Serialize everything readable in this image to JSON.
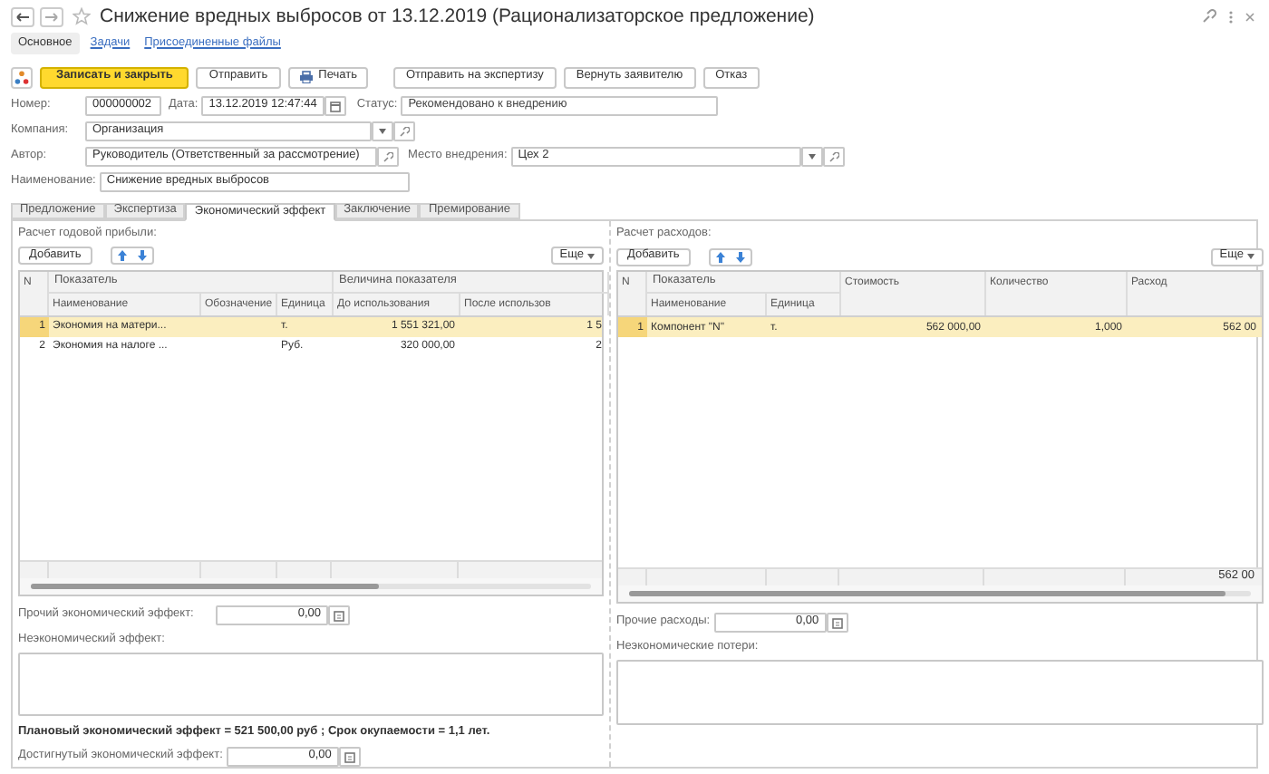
{
  "window": {
    "title": "Снижение вредных выбросов от 13.12.2019 (Рационализаторское предложение)"
  },
  "nav_tabs": [
    {
      "label": "Основное",
      "selected": true
    },
    {
      "label": "Задачи",
      "selected": false
    },
    {
      "label": "Присоединенные файлы",
      "selected": false
    }
  ],
  "toolbar": {
    "main": [
      {
        "label": "Записать и закрыть",
        "kind": "primary"
      },
      {
        "label": "Отправить",
        "kind": "plain"
      },
      {
        "label": "Печать",
        "kind": "print"
      }
    ],
    "actions": [
      {
        "label": "Отправить на экспертизу",
        "kind": "plain"
      },
      {
        "label": "Вернуть заявителю",
        "kind": "plain"
      },
      {
        "label": "Отказ",
        "kind": "plain"
      }
    ]
  },
  "header": {
    "number": {
      "label": "Номер:",
      "value": "000000002"
    },
    "date": {
      "label": "Дата:",
      "value": "13.12.2019 12:47:44"
    },
    "status": {
      "label": "Статус:",
      "value": "Рекомендовано к внедрению"
    },
    "company": {
      "label": "Компания:",
      "value": "Организация"
    },
    "author": {
      "label": "Автор:",
      "value": "Руководитель (Ответственный за рассмотрение)"
    },
    "place": {
      "label": "Место внедрения:",
      "value": "Цех 2"
    },
    "name": {
      "label": "Наименование:",
      "value": "Снижение вредных выбросов"
    }
  },
  "tabs": [
    {
      "label": "Предложение",
      "selected": false
    },
    {
      "label": "Экспертиза",
      "selected": false
    },
    {
      "label": "Экономический эффект",
      "selected": true
    },
    {
      "label": "Заключение",
      "selected": false
    },
    {
      "label": "Премирование",
      "selected": false
    }
  ],
  "profit": {
    "title": "Расчет годовой прибыли:",
    "add_button": "Добавить",
    "more_button": "Еще",
    "columns": [
      {
        "label": "N",
        "kind": "number"
      },
      {
        "label": "Показатель",
        "children": [
          {
            "label": "Наименование",
            "kind": "text"
          },
          {
            "label": "Обозначение",
            "kind": "text"
          },
          {
            "label": "Единица",
            "kind": "text"
          }
        ]
      },
      {
        "label": "Величина показателя",
        "children": [
          {
            "label": "До использования",
            "kind": "number"
          },
          {
            "label": "После использов",
            "kind": "number"
          }
        ]
      }
    ],
    "rows": [
      {
        "selected": true,
        "cells": [
          "1",
          [
            "Экономия на матери...",
            "",
            "т."
          ],
          [
            "1 551 321,00",
            "1 5"
          ]
        ]
      },
      {
        "selected": false,
        "cells": [
          "2",
          [
            "Экономия на налоге ...",
            "",
            "Руб."
          ],
          [
            "320 000,00",
            "2"
          ]
        ]
      }
    ],
    "other": {
      "label": "Прочий экономический эффект:",
      "value": "0,00"
    },
    "note": {
      "label": "Неэкономический эффект:"
    }
  },
  "costs": {
    "title": "Расчет расходов:",
    "add_button": "Добавить",
    "more_button": "Еще",
    "columns": [
      {
        "label": "N",
        "kind": "number"
      },
      {
        "label": "Показатель",
        "children": [
          {
            "label": "Наименование",
            "kind": "text"
          },
          {
            "label": "Единица",
            "kind": "text"
          }
        ]
      },
      {
        "label": "Стоимость",
        "kind": "number"
      },
      {
        "label": "Количество",
        "kind": "number"
      },
      {
        "label": "Расход",
        "kind": "number"
      }
    ],
    "rows": [
      {
        "selected": true,
        "cells": [
          "1",
          [
            "Компонент \"N\"",
            "т."
          ],
          "562 000,00",
          "1,000",
          "562 00"
        ]
      }
    ],
    "footer_total": "562 00",
    "other": {
      "label": "Прочие расходы:",
      "value": "0,00"
    },
    "note": {
      "label": "Неэкономические потери:"
    }
  },
  "summary": "Плановый экономический эффект = 521 500,00 руб ; Срок окупаемости = 1,1 лет.",
  "achieved": {
    "label": "Достигнутый экономический эффект:",
    "value": "0,00"
  }
}
